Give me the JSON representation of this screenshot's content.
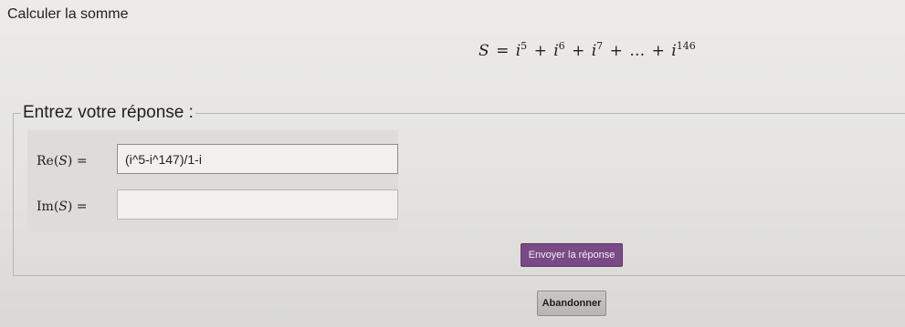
{
  "problem": {
    "title": "Calculer la somme",
    "formula": {
      "lhs": "S",
      "equals": "=",
      "base": "i",
      "terms_exponents": [
        "5",
        "6",
        "7"
      ],
      "plus": "+",
      "ellipsis": "…",
      "last_exponent": "146"
    }
  },
  "answer_section": {
    "legend": "Entrez votre réponse :",
    "re": {
      "label_fn": "Re",
      "label_var": "S",
      "label_eq": "=",
      "value": "(i^5-i^147)/1-i"
    },
    "im": {
      "label_fn": "Im",
      "label_var": "S",
      "label_eq": "=",
      "value": ""
    }
  },
  "buttons": {
    "submit_label": "Envoyer la réponse",
    "abandon_label": "Abandonner"
  },
  "colors": {
    "submit_button": "#7a4a86",
    "abandon_button": "#bebdb9",
    "background": "#e6e5e1"
  }
}
